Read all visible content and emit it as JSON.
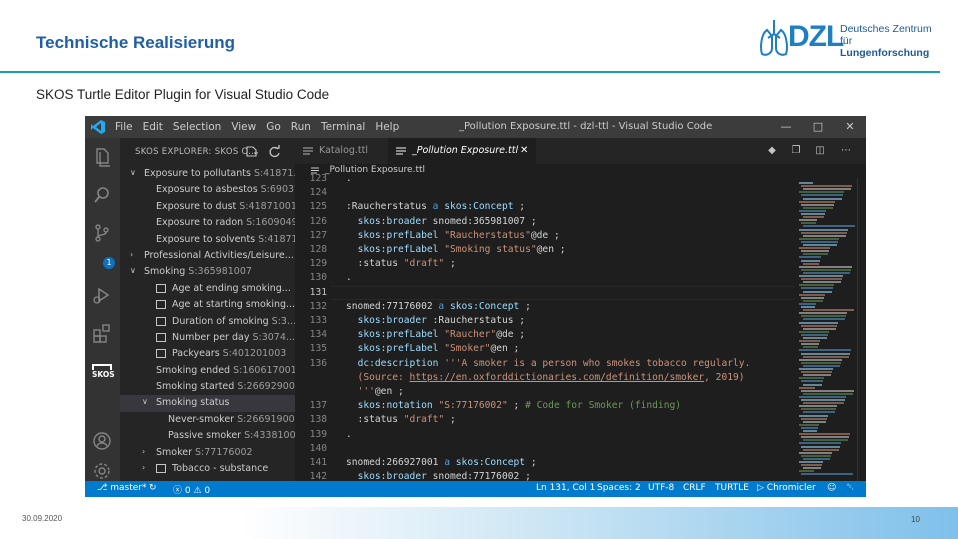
{
  "slide": {
    "title": "Technische Realisierung",
    "subtitle": "SKOS Turtle Editor Plugin for Visual Studio Code",
    "logo": {
      "abbr": "DZL",
      "line1": "Deutsches Zentrum für",
      "line2": "Lungenforschung"
    },
    "footer": {
      "date": "30.09.2020",
      "page": "10"
    },
    "colors": {
      "title": "#1f5fa8",
      "rule": "#1aa0a8",
      "logo": "#1e7fc2"
    }
  },
  "vscode": {
    "menu": [
      "File",
      "Edit",
      "Selection",
      "View",
      "Go",
      "Run",
      "Terminal",
      "Help"
    ],
    "window_title": "_Pollution Exposure.ttl - dzl-ttl - Visual Studio Code",
    "window_controls": [
      "minimize-icon",
      "maximize-icon",
      "close-icon"
    ],
    "activity_bar": {
      "icons": [
        "files-icon",
        "search-icon",
        "source-control-icon",
        "run-debug-icon",
        "extensions-icon",
        "skos-icon",
        "account-icon",
        "gear-icon"
      ],
      "badge": "1",
      "skos_label": "SKOS"
    },
    "sidebar": {
      "header": "SKOS EXPLORER: SKOS O...",
      "header_icons": [
        "new-file-icon",
        "refresh-icon"
      ],
      "tree": [
        {
          "level": 0,
          "expand": "open",
          "label": "Exposure to pollutants",
          "id": "S:41871...",
          "checkbox": false
        },
        {
          "level": 1,
          "expand": "none",
          "label": "Exposure to asbestos",
          "id": "S:69037...",
          "checkbox": false
        },
        {
          "level": 1,
          "expand": "none",
          "label": "Exposure to dust",
          "id": "S:41871001...",
          "checkbox": false
        },
        {
          "level": 1,
          "expand": "none",
          "label": "Exposure to radon",
          "id": "S:1609049...",
          "checkbox": false
        },
        {
          "level": 1,
          "expand": "none",
          "label": "Exposure to solvents",
          "id": "S:41871...",
          "checkbox": false
        },
        {
          "level": 0,
          "expand": "closed",
          "label": "Professional Activities/Leisure...",
          "id": "",
          "checkbox": false
        },
        {
          "level": 0,
          "expand": "open",
          "label": "Smoking",
          "id": "S:365981007",
          "checkbox": false
        },
        {
          "level": 1,
          "expand": "none",
          "label": "Age at ending smoking...",
          "id": "",
          "checkbox": true
        },
        {
          "level": 1,
          "expand": "none",
          "label": "Age at starting smoking...",
          "id": "",
          "checkbox": true
        },
        {
          "level": 1,
          "expand": "none",
          "label": "Duration of smoking",
          "id": "S:3...",
          "checkbox": true
        },
        {
          "level": 1,
          "expand": "none",
          "label": "Number per day",
          "id": "S:3074...",
          "checkbox": true
        },
        {
          "level": 1,
          "expand": "none",
          "label": "Packyears",
          "id": "S:401201003",
          "checkbox": true
        },
        {
          "level": 1,
          "expand": "none",
          "label": "Smoking ended",
          "id": "S:160617001",
          "checkbox": false
        },
        {
          "level": 1,
          "expand": "none",
          "label": "Smoking started",
          "id": "S:266929003",
          "checkbox": false
        },
        {
          "level": 1,
          "expand": "open",
          "label": "Smoking status",
          "id": "",
          "checkbox": false,
          "selected": true
        },
        {
          "level": 2,
          "expand": "none",
          "label": "Never-smoker",
          "id": "S:266919005",
          "checkbox": false
        },
        {
          "level": 2,
          "expand": "none",
          "label": "Passive smoker",
          "id": "S:43381005",
          "checkbox": false
        },
        {
          "level": 1,
          "expand": "closed",
          "label": "Smoker",
          "id": "S:77176002",
          "checkbox": false
        },
        {
          "level": 1,
          "expand": "closed",
          "label": "Tobacco - substance",
          "id": "",
          "checkbox": true
        }
      ]
    },
    "tabs": [
      {
        "label": "Katalog.ttl",
        "active": false
      },
      {
        "label": "_Pollution Exposure.ttl",
        "active": true
      }
    ],
    "tab_actions": [
      "diamond-icon",
      "copy-icon",
      "split-icon",
      "more-icon"
    ],
    "breadcrumb": "_Pollution Exposure.ttl",
    "code_lines": [
      {
        "ln": "123",
        "html": "<span class='w'>.</span>"
      },
      {
        "ln": "124",
        "html": ""
      },
      {
        "ln": "125",
        "html": "<span class='w'>:Raucherstatus </span><span class='k'>a</span><span class='w'> </span><span class='p'>skos:Concept</span><span class='w'> ;</span>"
      },
      {
        "ln": "126",
        "html": "<span class='w'>  </span><span class='p'>skos:broader</span><span class='w'> snomed:365981007 ;</span>"
      },
      {
        "ln": "127",
        "html": "<span class='w'>  </span><span class='p'>skos:prefLabel</span><span class='w'> </span><span class='s'>\"Raucherstatus\"</span><span class='w'>@de ;</span>"
      },
      {
        "ln": "128",
        "html": "<span class='w'>  </span><span class='p'>skos:prefLabel</span><span class='w'> </span><span class='s'>\"Smoking status\"</span><span class='w'>@en ;</span>"
      },
      {
        "ln": "129",
        "html": "<span class='w'>  :status </span><span class='s'>\"draft\"</span><span class='w'> ;</span>"
      },
      {
        "ln": "130",
        "html": "<span class='w'>.</span>"
      },
      {
        "ln": "131",
        "html": "",
        "current": true
      },
      {
        "ln": "132",
        "html": "<span class='w'>snomed:77176002 </span><span class='k'>a</span><span class='w'> </span><span class='p'>skos:Concept</span><span class='w'> ;</span>"
      },
      {
        "ln": "133",
        "html": "<span class='w'>  </span><span class='p'>skos:broader</span><span class='w'> :Raucherstatus ;</span>"
      },
      {
        "ln": "134",
        "html": "<span class='w'>  </span><span class='p'>skos:prefLabel</span><span class='w'> </span><span class='s'>\"Raucher\"</span><span class='w'>@de ;</span>"
      },
      {
        "ln": "135",
        "html": "<span class='w'>  </span><span class='p'>skos:prefLabel</span><span class='w'> </span><span class='s'>\"Smoker\"</span><span class='w'>@en ;</span>"
      },
      {
        "ln": "136",
        "html": "<span class='w'>  </span><span class='p'>dc:description</span><span class='w'> </span><span class='s'>'''A smoker is a person who smokes tobacco regularly.</span>"
      },
      {
        "ln": "",
        "html": "<span class='s'>  (Source: </span><span class='u'>https://en.oxforddictionaries.com/definition/smoker</span><span class='s'>, 2019)</span>"
      },
      {
        "ln": "",
        "html": "<span class='s'>  '''</span><span class='w'>@en ;</span>"
      },
      {
        "ln": "137",
        "html": "<span class='w'>  </span><span class='p'>skos:notation</span><span class='w'> </span><span class='s'>\"S:77176002\"</span><span class='w'> ; </span><span class='c'># Code for Smoker (finding)</span>"
      },
      {
        "ln": "138",
        "html": "<span class='w'>  :status </span><span class='s'>\"draft\"</span><span class='w'> ;</span>"
      },
      {
        "ln": "139",
        "html": "<span class='w'>.</span>"
      },
      {
        "ln": "140",
        "html": ""
      },
      {
        "ln": "141",
        "html": "<span class='w'>snomed:266927001 </span><span class='k'>a</span><span class='w'> </span><span class='p'>skos:Concept</span><span class='w'> ;</span>"
      },
      {
        "ln": "142",
        "html": "<span class='w'>  </span><span class='p'>skos:broader</span><span class='w'> snomed:77176002 ;</span>"
      }
    ],
    "status_bar": {
      "branch": "master*",
      "sync": "sync-icon",
      "problems": "ⓧ 0 ⚠ 0",
      "position": "Ln 131, Col 1",
      "spaces": "Spaces: 2",
      "encoding": "UTF-8",
      "eol": "CRLF",
      "language": "TURTLE",
      "extension": "Chromicler",
      "feedback": "feedback-icon",
      "bell": "bell-icon"
    },
    "colors": {
      "statusbar": "#007acc",
      "titlebar": "#3c3c3c",
      "editor_bg": "#1e1e1e",
      "sidebar_bg": "#252526"
    }
  }
}
